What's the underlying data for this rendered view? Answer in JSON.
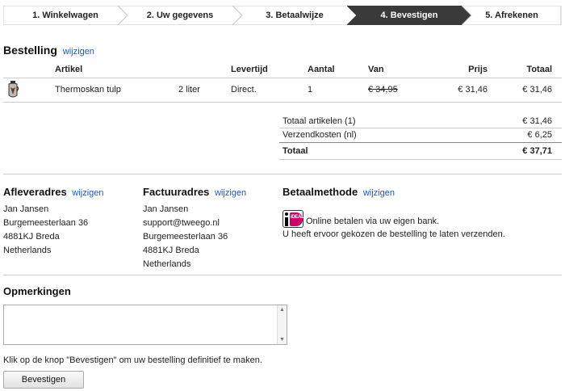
{
  "steps": [
    {
      "label": "1. Winkelwagen",
      "active": false
    },
    {
      "label": "2. Uw gegevens",
      "active": false
    },
    {
      "label": "3. Betaalwijze",
      "active": false
    },
    {
      "label": "4. Bevestigen",
      "active": true
    },
    {
      "label": "5. Afrekenen",
      "active": false
    }
  ],
  "colors": {
    "active_step_bg": "#3a3a3a",
    "step_bg": "#ffffff",
    "link": "#1a57d6",
    "ideal_pink": "#cc0066"
  },
  "order": {
    "title": "Bestelling",
    "edit_link": "wijzigen",
    "columns": {
      "artikel": "Artikel",
      "levertijd": "Levertijd",
      "aantal": "Aantal",
      "van": "Van",
      "prijs": "Prijs",
      "totaal": "Totaal"
    },
    "item": {
      "icon": "thermos-product-icon",
      "name": "Thermoskan tulp",
      "variant": "2 liter",
      "levertijd": "Direct.",
      "aantal": "1",
      "van": "€ 34,95",
      "prijs": "€ 31,46",
      "totaal": "€ 31,46"
    },
    "summary": {
      "items_label": "Totaal artikelen (1)",
      "items_value": "€ 31,46",
      "shipping_label": "Verzendkosten (nl)",
      "shipping_value": "€ 6,25",
      "total_label": "Totaal",
      "total_value": "€ 37,71"
    }
  },
  "delivery": {
    "title": "Afleveradres",
    "edit_link": "wijzigen",
    "lines": [
      "Jan Jansen",
      "Burgemeesterlaan 36",
      "4881KJ Breda",
      "Netherlands"
    ]
  },
  "invoice": {
    "title": "Factuuradres",
    "edit_link": "wijzigen",
    "lines": [
      "Jan Jansen",
      "support@tweego.nl",
      "Burgemeesterlaan 36",
      "4881KJ Breda",
      "Netherlands"
    ]
  },
  "payment": {
    "title": "Betaalmethode",
    "edit_link": "wijzigen",
    "logo_text": "iDEAL",
    "line1": "Online betalen via uw eigen bank.",
    "line2": "U heeft ervoor gekozen de bestelling te laten verzenden."
  },
  "remarks": {
    "title": "Opmerkingen",
    "value": ""
  },
  "confirm": {
    "instruction": "Klik op de knop \"Bevestigen\" om uw bestelling definitief te maken.",
    "button_label": "Bevestigen"
  }
}
